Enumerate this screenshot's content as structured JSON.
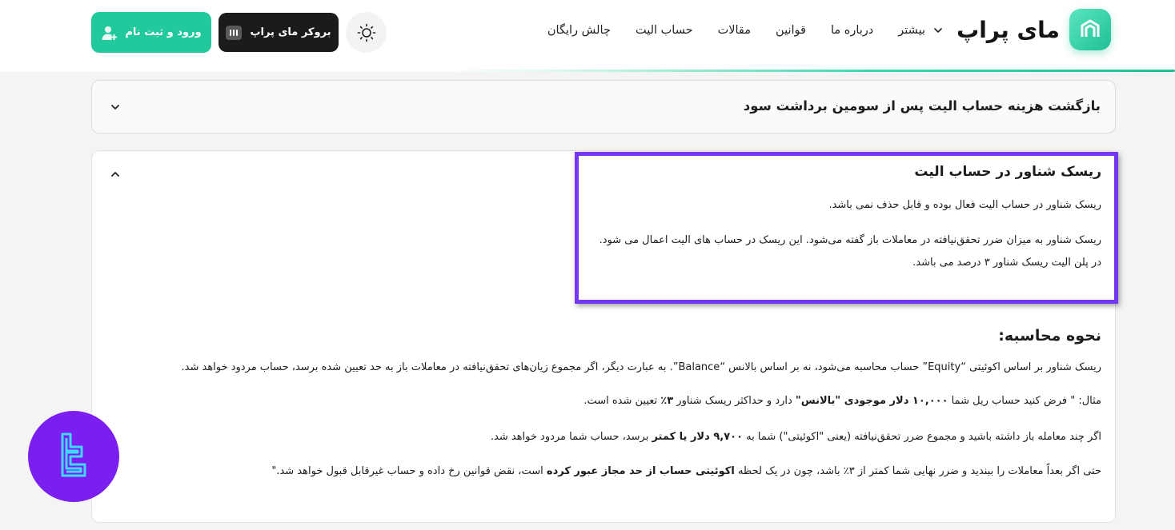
{
  "header": {
    "logo_text": "مای پراپ",
    "nav": [
      {
        "label": "چالش رایگان"
      },
      {
        "label": "حساب الیت"
      },
      {
        "label": "مقالات"
      },
      {
        "label": "قوانین"
      },
      {
        "label": "درباره ما"
      },
      {
        "label": "بیشتر"
      }
    ],
    "broker_label": "بروکر مای پراپ",
    "login_label": "ورود و ثبت نام"
  },
  "accordion_collapsed": {
    "title": "بازگشت هزینه حساب الیت پس از سومین برداشت سود"
  },
  "floating_risk": {
    "title": "ریسک شناور در حساب الیت",
    "p1": "ریسک شناور در حساب الیت فعال بوده و قابل حذف نمی باشد.",
    "p2": "ریسک شناور به میزان ضرر تحقق‌نیافته در معاملات باز گفته می‌شود. این ریسک در حساب های الیت اعمال می شود.",
    "p3": "در پلن الیت ریسک شناور ۳ درصد می باشد."
  },
  "calculation": {
    "title": "نحوه محاسبه:",
    "line1": "ریسک شناور بر اساس اکوئیتی “Equity” حساب محاسبه می‌شود، نه بر اساس بالانس “Balance”. به عبارت دیگر، اگر مجموع زیان‌های تحقق‌نیافته در معاملات باز به حد تعیین شده برسد، حساب مردود خواهد شد.",
    "line2_a": "مثال: \" فرض کنید حساب ریل شما ",
    "line2_b": "۱۰,۰۰۰ دلار موجودی \"بالانس\"",
    "line2_c": " دارد و حداکثر ریسک شناور ",
    "line2_d": "۳٪",
    "line2_e": " تعیین شده است.",
    "line3_a": "اگر چند معامله باز داشته باشید و مجموع ضرر تحقق‌نیافته (یعنی \"اکوئیتی\") شما به ",
    "line3_b": "۹,۷۰۰ دلار یا کمتر",
    "line3_c": " برسد، حساب شما مردود خواهد شد.",
    "line4_a": "حتی اگر بعداً معاملات را ببندید و ضرر نهایی شما کمتر از ۳٪ باشد، چون در یک لحظه ",
    "line4_b": "اکوئیتی حساب از حد مجاز عبور کرده",
    "line4_c": " است، نقض قوانین رخ داده و حساب غیرقابل قبول خواهد شد.\""
  },
  "colors": {
    "accent": "#22c99d",
    "highlight": "#7438f2",
    "badge": "#7a1ff0"
  },
  "icons": [
    "logo-mark-icon",
    "chevron-down-icon",
    "sun-icon",
    "broker-icon",
    "user-add-icon",
    "chevron-up-icon",
    "tradingfinder-badge-icon"
  ]
}
